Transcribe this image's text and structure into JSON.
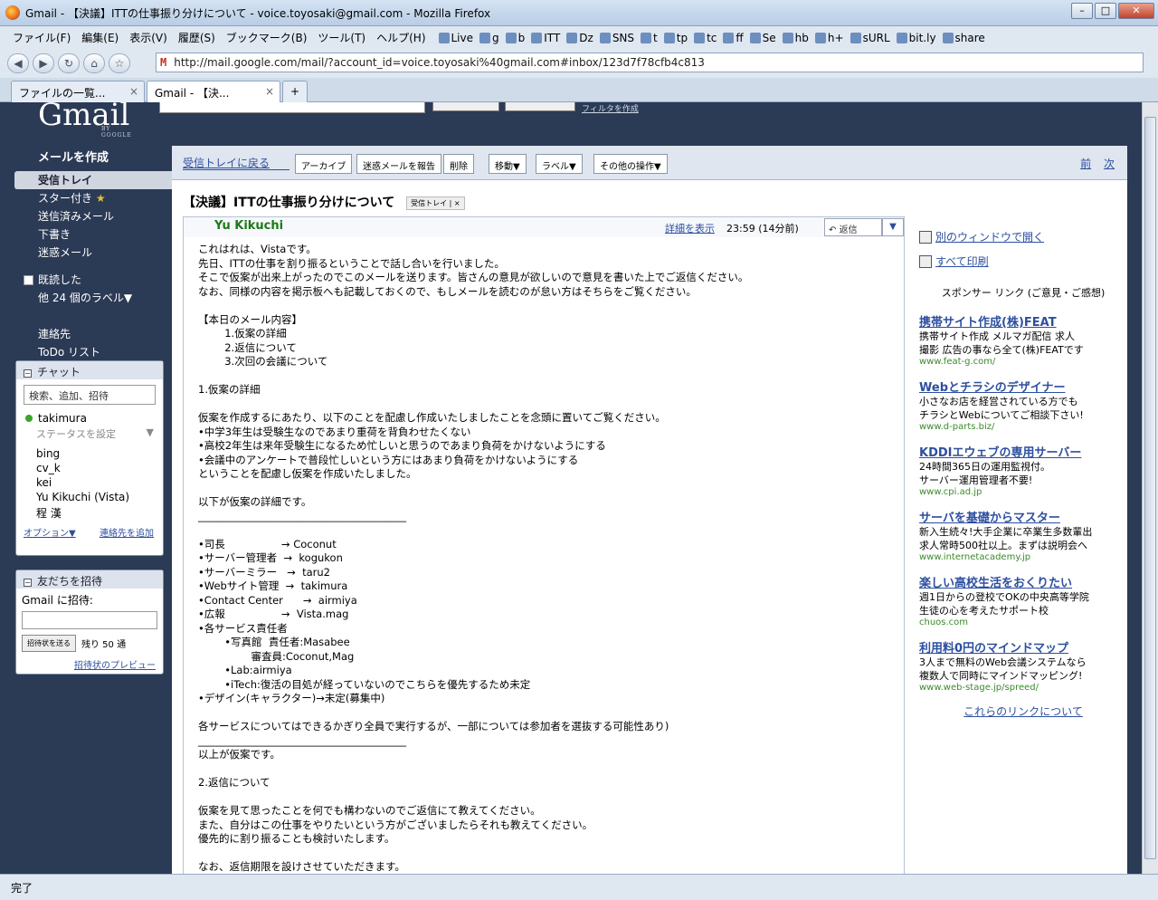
{
  "window": {
    "title": "Gmail - 【決議】ITTの仕事振り分けについて - voice.toyosaki@gmail.com - Mozilla Firefox"
  },
  "menubar": {
    "items": [
      "ファイル(F)",
      "編集(E)",
      "表示(V)",
      "履歴(S)",
      "ブックマーク(B)",
      "ツール(T)",
      "ヘルプ(H)"
    ],
    "bookmarks": [
      "Live",
      "g",
      "b",
      "ITT",
      "Dz",
      "SNS",
      "t",
      "tp",
      "tc",
      "ff",
      "Se",
      "hb",
      "h+",
      "sURL",
      "bit.ly",
      "share"
    ]
  },
  "navbar": {
    "url": "http://mail.google.com/mail/?account_id=voice.toyosaki%40gmail.com#inbox/123d7f78cfb4c813"
  },
  "tabs": [
    {
      "label": "ファイルの一覧...",
      "active": false
    },
    {
      "label": "Gmail - 【決...",
      "active": true
    }
  ],
  "status": {
    "text": "完了"
  },
  "gmail": {
    "logo_sub": "BY GOOGLE",
    "filter_link": "フィルタを作成",
    "compose": "メールを作成",
    "nav": [
      "受信トレイ",
      "スター付き",
      "送信済みメール",
      "下書き",
      "迷惑メール"
    ],
    "nav2": [
      "既読した",
      "他 24 個のラベル▼",
      "",
      "連絡先",
      "ToDo リスト"
    ],
    "chat": {
      "title": "チャット",
      "search": "検索、追加、招待",
      "me": "takimura",
      "status": "ステータスを設定",
      "contacts": [
        "bing",
        "cv_k",
        "kei",
        "Yu Kikuchi (Vista)",
        "程 漢"
      ],
      "options": "オプション▼",
      "add": "連絡先を追加"
    },
    "invite": {
      "title": "友だちを招待",
      "label": "Gmail に招待:",
      "button": "招待状を送る",
      "remaining": "残り 50 通",
      "preview": "招待状のプレビュー"
    },
    "toolbar": {
      "back": "受信トレイに戻る",
      "archive": "アーカイブ",
      "spam": "迷惑メールを報告",
      "delete": "削除",
      "move": "移動▼",
      "label": "ラベル▼",
      "more": "その他の操作▼",
      "prev": "前",
      "next": "次"
    },
    "subject": "【決議】ITTの仕事振り分けについて",
    "subject_label": "受信トレイ | ×",
    "message": {
      "sender": "Yu Kikuchi",
      "details": "詳細を表示",
      "time": "23:59 (14分前)",
      "reply": "返信",
      "body": "これはれは、Vistaです。\n先日、ITTの仕事を割り振るということで話し合いを行いました。\nそこで仮案が出来上がったのでこのメールを送ります。皆さんの意見が欲しいので意見を書いた上でご返信ください。\nなお、同様の内容を掲示板へも記載しておくので、もしメールを読むのが怠い方はそちらをご覧ください。\n\n【本日のメール内容】\n        1.仮案の詳細\n        2.返信について\n        3.次回の会議について\n\n1.仮案の詳細\n\n仮案を作成するにあたり、以下のことを配慮し作成いたしましたことを念頭に置いてご覧ください。\n•中学3年生は受験生なのであまり重荷を背負わせたくない\n•高校2年生は来年受験生になるため忙しいと思うのであまり負荷をかけないようにする\n•会議中のアンケートで普段忙しいという方にはあまり負荷をかけないようにする\nということを配慮し仮案を作成いたしました。\n\n以下が仮案の詳細です。\n________________________________________\n\n•司長                 → Coconut\n•サーバー管理者  →  kogukon\n•サーバーミラー   →  taru2\n•Webサイト管理  →  takimura\n•Contact Center      →  airmiya\n•広報                 →  Vista.mag\n•各サービス責任者\n        •写真館  責任者:Masabee\n                審査員:Coconut,Mag\n        •Lab:airmiya\n        •iTech:復活の目処が経っていないのでこちらを優先するため未定\n•デザイン(キャラクター)→未定(募集中)\n\n各サービスについてはできるかぎり全員で実行するが、一部については参加者を選抜する可能性あり)\n________________________________________\n以上が仮案です。\n\n2.返信について\n\n仮案を見て思ったことを何でも構わないのでご返信にて教えてください。\nまた、自分はこの仕事をやりたいという方がございましたらそれも教えてください。\n優先的に割り振ることも検討いたします。\n\nなお、返信期限を設けさせていただきます。"
    },
    "right": {
      "new_window": "別のウィンドウで開く",
      "print_all": "すべて印刷",
      "sponsor": "スポンサー リンク (ご意見・ご感想)",
      "ads": [
        {
          "title": "携帯サイト作成(株)FEAT",
          "desc": "携帯サイト作成 メルマガ配信 求人\n撮影 広告の事なら全て(株)FEATです",
          "url": "www.feat-g.com/"
        },
        {
          "title": "Webとチラシのデザイナー",
          "desc": "小さなお店を経営されている方でも\nチラシとWebについてご相談下さい!",
          "url": "www.d-parts.biz/"
        },
        {
          "title": "KDDIエウェブの専用サーバー",
          "desc": "24時間365日の運用監視付。\nサーバー運用管理者不要!",
          "url": "www.cpi.ad.jp"
        },
        {
          "title": "サーバを基礎からマスター",
          "desc": "新入生続々!大手企業に卒業生多数輩出\n求人常時500社以上。まずは説明会へ",
          "url": "www.internetacademy.jp"
        },
        {
          "title": "楽しい高校生活をおくりたい",
          "desc": "週1日からの登校でOKの中央高等学院\n生徒の心を考えたサポート校",
          "url": "chuos.com"
        },
        {
          "title": "利用料0円のマインドマップ",
          "desc": "3人まで無料のWeb会議システムなら\n複数人で同時にマインドマッピング!",
          "url": "www.web-stage.jp/spreed/"
        }
      ],
      "about": "これらのリンクについて"
    }
  }
}
